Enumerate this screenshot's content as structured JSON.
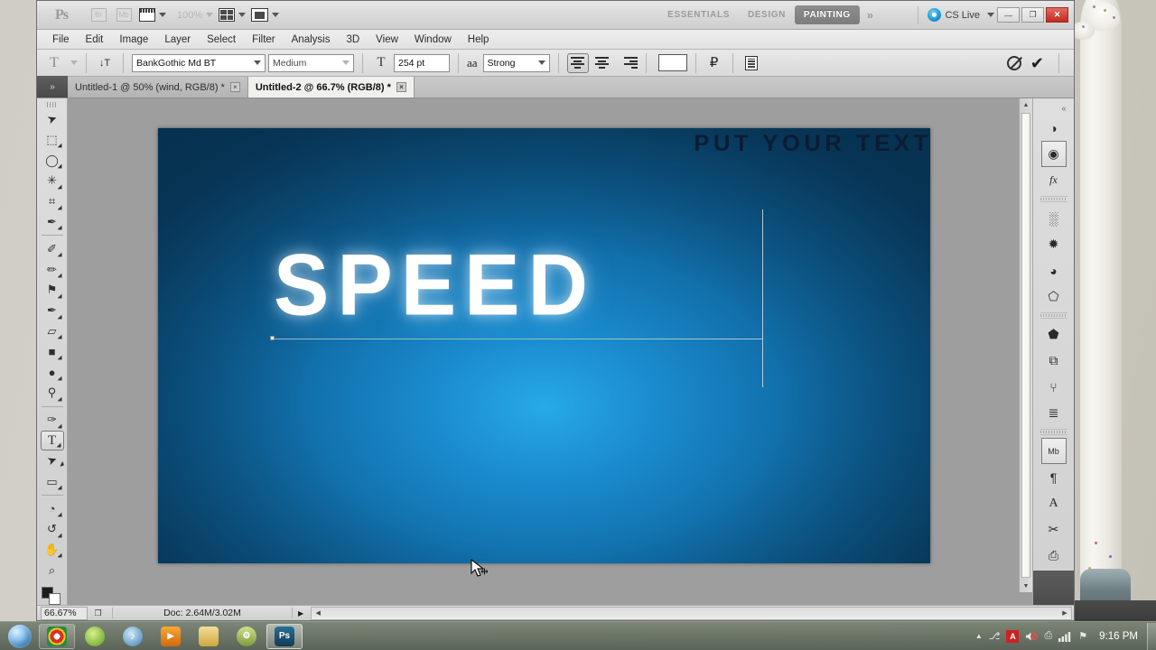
{
  "app": {
    "logo": "Ps",
    "bridge_icon": "Br",
    "minibridge_icon": "Mb",
    "zoom_level_appbar": "100%",
    "workspaces": [
      {
        "label": "ESSENTIALS",
        "active": false
      },
      {
        "label": "DESIGN",
        "active": false
      },
      {
        "label": "PAINTING",
        "active": true
      }
    ],
    "workspace_more": "»",
    "cs_live_label": "CS Live",
    "window_buttons": {
      "minimize": "—",
      "restore": "❐",
      "close": "✕"
    }
  },
  "menubar": {
    "items": [
      "File",
      "Edit",
      "Image",
      "Layer",
      "Select",
      "Filter",
      "Analysis",
      "3D",
      "View",
      "Window",
      "Help"
    ]
  },
  "options_bar": {
    "tool_glyph": "T",
    "orientation_icon": "↓T",
    "font_family": "BankGothic Md BT",
    "font_style": "Medium",
    "size_icon": "T",
    "font_size": "254 pt",
    "antialias_glyph": "aa",
    "antialias": "Strong",
    "alignment": [
      "left",
      "center",
      "right"
    ],
    "alignment_selected": "left",
    "text_color": "#ffffff",
    "warp_label": "warp-text",
    "panels_label": "toggle-panels",
    "cancel": "⊘",
    "commit": "✔"
  },
  "tabs": {
    "collapse_glyph": "»",
    "documents": [
      {
        "title": "Untitled-1 @ 50% (wind, RGB/8) *",
        "active": false,
        "close": "×"
      },
      {
        "title": "Untitled-2 @ 66.7% (RGB/8) *",
        "active": true,
        "close": "×"
      }
    ]
  },
  "toolbar": {
    "tools": [
      {
        "name": "move-tool",
        "glyph": "➤",
        "selected": false
      },
      {
        "name": "rectangular-marquee-tool",
        "glyph": "⬚",
        "selected": false
      },
      {
        "name": "lasso-tool",
        "glyph": "◯",
        "selected": false
      },
      {
        "name": "quick-selection-tool",
        "glyph": "✳",
        "selected": false
      },
      {
        "name": "crop-tool",
        "glyph": "⌗",
        "selected": false
      },
      {
        "name": "eyedropper-tool",
        "glyph": "✒",
        "selected": false
      },
      {
        "name": "spot-healing-brush-tool",
        "glyph": "✐",
        "selected": false
      },
      {
        "name": "brush-tool",
        "glyph": "✏",
        "selected": false
      },
      {
        "name": "clone-stamp-tool",
        "glyph": "⚑",
        "selected": false
      },
      {
        "name": "history-brush-tool",
        "glyph": "✒",
        "selected": false
      },
      {
        "name": "eraser-tool",
        "glyph": "▱",
        "selected": false
      },
      {
        "name": "gradient-tool",
        "glyph": "■",
        "selected": false
      },
      {
        "name": "blur-tool",
        "glyph": "●",
        "selected": false
      },
      {
        "name": "dodge-tool",
        "glyph": "⚲",
        "selected": false
      },
      {
        "name": "pen-tool",
        "glyph": "✑",
        "selected": false
      },
      {
        "name": "horizontal-type-tool",
        "glyph": "T",
        "selected": true
      },
      {
        "name": "path-selection-tool",
        "glyph": "➤",
        "selected": false
      },
      {
        "name": "rectangle-shape-tool",
        "glyph": "▭",
        "selected": false
      },
      {
        "name": "3d-rotate-tool",
        "glyph": "◔",
        "selected": false
      },
      {
        "name": "3d-orbit-tool",
        "glyph": "↺",
        "selected": false
      },
      {
        "name": "hand-tool",
        "glyph": "✋",
        "selected": false
      },
      {
        "name": "zoom-tool",
        "glyph": "⌕",
        "selected": false
      }
    ],
    "foreground_color": "#1c1c1c",
    "background_color": "#ffffff"
  },
  "canvas": {
    "headline": "PUT YOUR TEXT",
    "main_text": "SPEED",
    "text_color": "#ffffff",
    "headline_color": "#0b1c33",
    "background_center_color": "#27a9e8",
    "background_edge_color": "#0a4066"
  },
  "statusbar": {
    "zoom": "66.67%",
    "thumb_icon": "❐",
    "doc_info": "Doc: 2.64M/3.02M",
    "play_glyph": "▶",
    "left_arrow": "◀",
    "right_arrow": "▶"
  },
  "right_dock": {
    "collapse_glyph": "«",
    "groups": [
      [
        {
          "name": "adjustments-panel-icon",
          "glyph": "◑"
        },
        {
          "name": "masks-panel-icon",
          "glyph": "◉"
        },
        {
          "name": "styles-fx-panel-icon",
          "glyph": "fx"
        }
      ],
      [
        {
          "name": "3d-materials-panel-icon",
          "glyph": "░"
        },
        {
          "name": "3d-lights-panel-icon",
          "glyph": "✹"
        },
        {
          "name": "3d-scene-panel-icon",
          "glyph": "◕"
        },
        {
          "name": "3d-mesh-panel-icon",
          "glyph": "⬠"
        }
      ],
      [
        {
          "name": "layers-panel-icon",
          "glyph": "⬟"
        },
        {
          "name": "channels-panel-icon",
          "glyph": "⧉"
        },
        {
          "name": "paths-panel-icon",
          "glyph": "⑂"
        },
        {
          "name": "history-panel-icon",
          "glyph": "≣"
        }
      ],
      [
        {
          "name": "mini-bridge-panel-icon",
          "glyph": "Mb"
        },
        {
          "name": "paragraph-panel-icon",
          "glyph": "¶"
        },
        {
          "name": "character-panel-icon",
          "glyph": "A"
        },
        {
          "name": "tool-presets-panel-icon",
          "glyph": "✂"
        },
        {
          "name": "animation-panel-icon",
          "glyph": "⎙"
        }
      ]
    ]
  },
  "taskbar": {
    "start_label": "start-orb",
    "items": [
      {
        "name": "taskbar-chrome",
        "glyph": "◎",
        "color": "#4aa64a",
        "active": false,
        "first": true
      },
      {
        "name": "taskbar-app-green",
        "glyph": "●",
        "color": "#7cbb3f",
        "active": false,
        "first": false
      },
      {
        "name": "taskbar-music",
        "glyph": "♪",
        "color": "#5a9ec9",
        "active": false,
        "first": false
      },
      {
        "name": "taskbar-media-player",
        "glyph": "▶",
        "color": "#e8891a",
        "active": false,
        "first": false
      },
      {
        "name": "taskbar-explorer",
        "glyph": "▰",
        "color": "#d9b23f",
        "active": false,
        "first": false
      },
      {
        "name": "taskbar-utility",
        "glyph": "⚙",
        "color": "#8fae4e",
        "active": false,
        "first": false
      },
      {
        "name": "taskbar-photoshop",
        "glyph": "Ps",
        "color": "#1c4f72",
        "active": true,
        "first": false
      }
    ],
    "tray": [
      {
        "name": "tray-show-hidden-icon",
        "glyph": "▲"
      },
      {
        "name": "tray-usb-icon",
        "glyph": "⎇"
      },
      {
        "name": "tray-adobe-updater-icon",
        "glyph": "A"
      },
      {
        "name": "tray-volume-muted-icon",
        "glyph": "🔇"
      },
      {
        "name": "tray-power-icon",
        "glyph": "⎙"
      },
      {
        "name": "tray-network-icon",
        "glyph": "▆"
      },
      {
        "name": "tray-action-center-icon",
        "glyph": "⚑"
      }
    ],
    "clock": "9:16 PM"
  }
}
